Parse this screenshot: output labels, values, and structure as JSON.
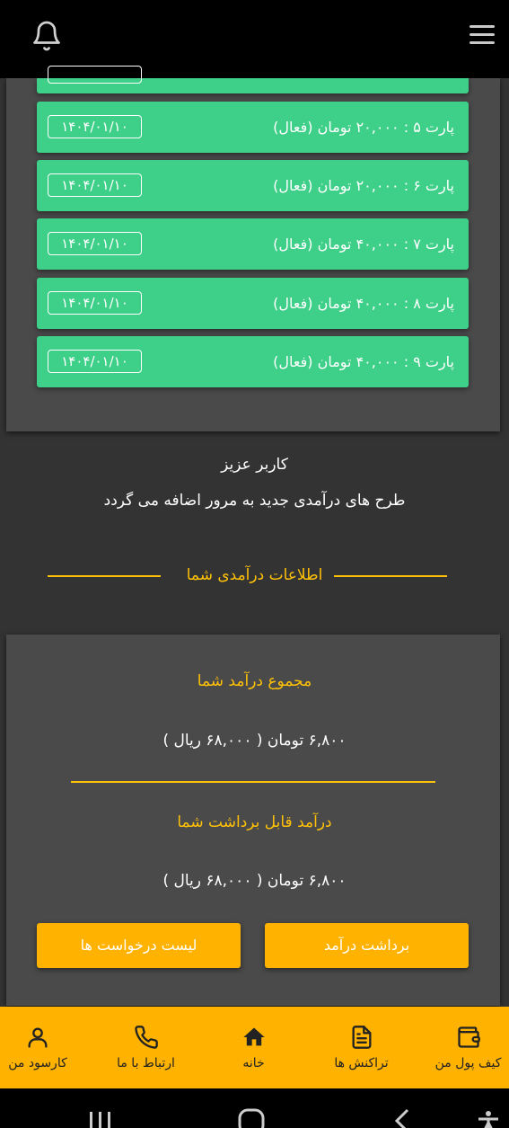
{
  "parts": [
    {
      "text": "پارت ۵ : ۲۰,۰۰۰ تومان (فعال)",
      "date": "۱۴۰۴/۰۱/۱۰"
    },
    {
      "text": "پارت ۶ : ۲۰,۰۰۰ تومان (فعال)",
      "date": "۱۴۰۴/۰۱/۱۰"
    },
    {
      "text": "پارت ۷ : ۴۰,۰۰۰ تومان (فعال)",
      "date": "۱۴۰۴/۰۱/۱۰"
    },
    {
      "text": "پارت ۸ : ۴۰,۰۰۰ تومان (فعال)",
      "date": "۱۴۰۴/۰۱/۱۰"
    },
    {
      "text": "پارت ۹ : ۴۰,۰۰۰ تومان (فعال)",
      "date": "۱۴۰۴/۰۱/۱۰"
    }
  ],
  "notice": {
    "line1": "کاربر عزیز",
    "line2": "طرح های درآمدی جدید به مرور اضافه می گردد"
  },
  "income_section": {
    "title": "اطلاعات درآمدی شما",
    "total_label": "مجموع درآمد شما",
    "total_value": "۶,۸۰۰ تومان ( ۶۸,۰۰۰ ریال )",
    "withdrawable_label": "درآمد قابل برداشت شما",
    "withdrawable_value": "۶,۸۰۰ تومان ( ۶۸,۰۰۰ ریال )",
    "withdraw_button": "برداشت درآمد",
    "requests_button": "لیست درخواست ها"
  },
  "bottom_nav": {
    "wallet": "کیف پول من",
    "transactions": "تراکنش ها",
    "home": "خانه",
    "contact": "ارتباط با ما",
    "profit": "کارسود من"
  },
  "colors": {
    "accent": "#ffb300",
    "active_green": "#3ecf88",
    "background": "#333333"
  }
}
